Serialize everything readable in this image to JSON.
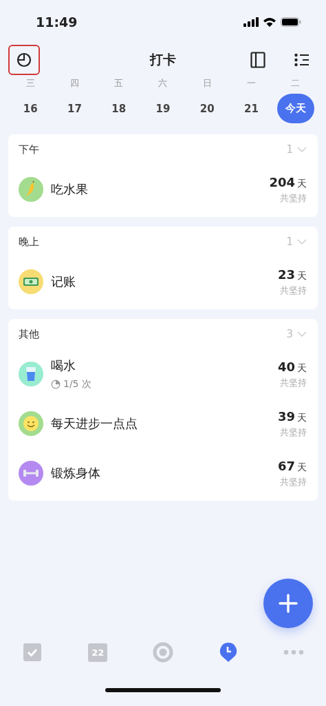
{
  "status_bar": {
    "time": "11:49"
  },
  "header": {
    "title": "打卡",
    "history_button": {
      "highlighted": true
    }
  },
  "week": [
    {
      "weekday": "三",
      "date": "16",
      "selected": false
    },
    {
      "weekday": "四",
      "date": "17",
      "selected": false
    },
    {
      "weekday": "五",
      "date": "18",
      "selected": false
    },
    {
      "weekday": "六",
      "date": "19",
      "selected": false
    },
    {
      "weekday": "日",
      "date": "20",
      "selected": false
    },
    {
      "weekday": "一",
      "date": "21",
      "selected": false
    },
    {
      "weekday": "二",
      "date": "今天",
      "selected": true
    }
  ],
  "groups": [
    {
      "title": "下午",
      "count": "1",
      "habits": [
        {
          "name": "吃水果",
          "kind": "banana",
          "color": "#a3dc8e",
          "days": "204",
          "unit": "天",
          "caption": "共坚持"
        }
      ]
    },
    {
      "title": "晚上",
      "count": "1",
      "habits": [
        {
          "name": "记账",
          "kind": "money",
          "color": "#f7dc74",
          "days": "23",
          "unit": "天",
          "caption": "共坚持"
        }
      ]
    },
    {
      "title": "其他",
      "count": "3",
      "habits": [
        {
          "name": "喝水",
          "kind": "water",
          "color": "#98ecd0",
          "days": "40",
          "unit": "天",
          "caption": "共坚持",
          "progress": "1/5 次"
        },
        {
          "name": "每天进步一点点",
          "kind": "smile",
          "color": "#a3dc8e",
          "days": "39",
          "unit": "天",
          "caption": "共坚持"
        },
        {
          "name": "锻炼身体",
          "kind": "dumbbell",
          "color": "#b48af0",
          "days": "67",
          "unit": "天",
          "caption": "共坚持"
        }
      ]
    }
  ],
  "tabs": [
    {
      "kind": "tasks",
      "selected": false
    },
    {
      "kind": "calendar",
      "label": "22",
      "selected": false
    },
    {
      "kind": "focus",
      "selected": false
    },
    {
      "kind": "habits",
      "selected": true
    },
    {
      "kind": "more",
      "selected": false
    }
  ]
}
